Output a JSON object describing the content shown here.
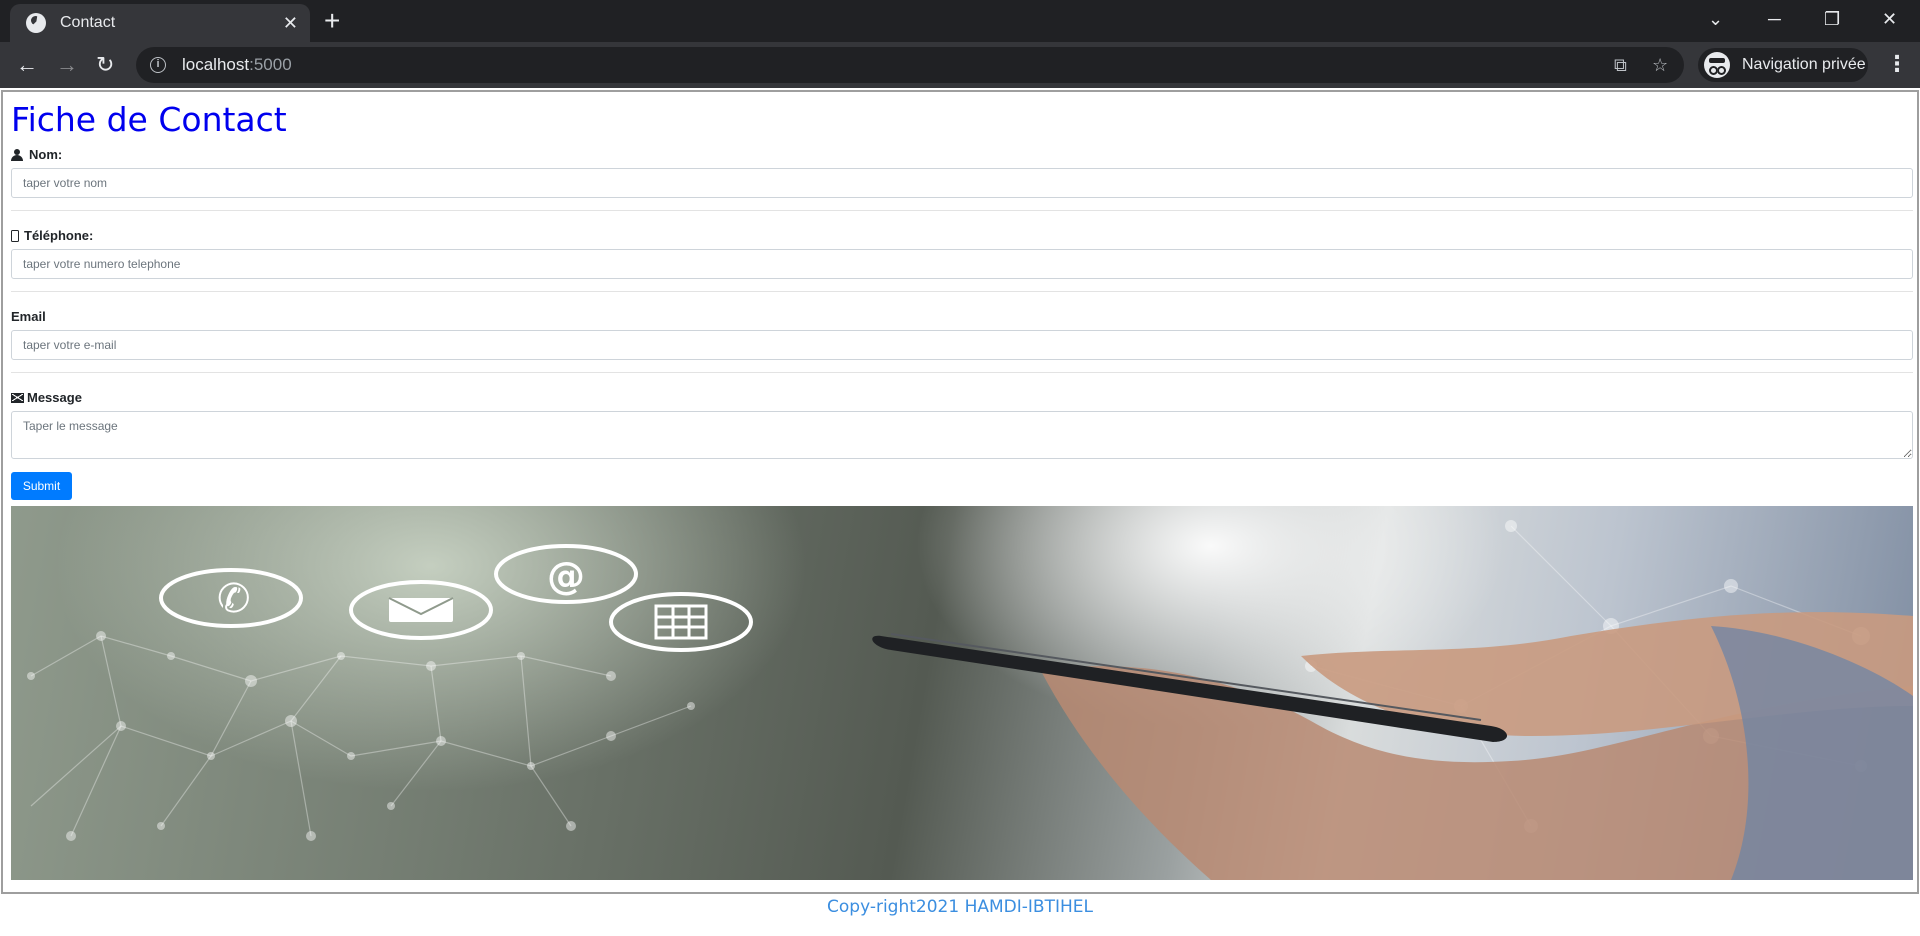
{
  "browser": {
    "tab_title": "Contact",
    "new_tab": "+",
    "url_host": "localhost",
    "url_port": ":5000",
    "profile_label": "Navigation privée"
  },
  "page": {
    "title": "Fiche de Contact",
    "fields": {
      "nom": {
        "label": "Nom:",
        "placeholder": "taper votre nom",
        "icon": "person-icon"
      },
      "telephone": {
        "label": "Téléphone:",
        "placeholder": "taper votre numero telephone",
        "icon": "phone-icon"
      },
      "email": {
        "label": "Email",
        "placeholder": "taper votre e-mail"
      },
      "message": {
        "label": "Message",
        "placeholder": "Taper le message",
        "icon": "envelope-icon"
      }
    },
    "submit_label": "Submit",
    "hero_image": "contact-hand-smartphone-network-icons",
    "footer": "Copy-right2021 HAMDI-IBTIHEL"
  },
  "colors": {
    "title": "#0000ee",
    "submit": "#007bff",
    "footer": "#3b8ee0"
  }
}
